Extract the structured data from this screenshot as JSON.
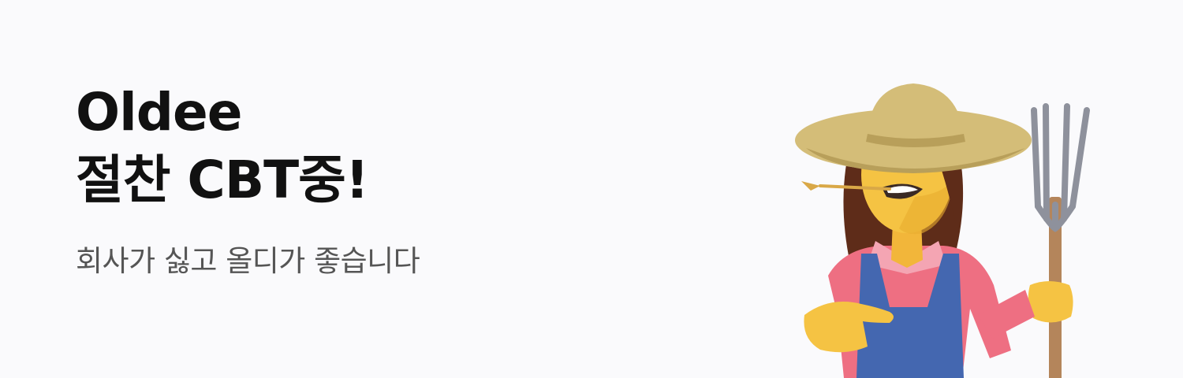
{
  "banner": {
    "title_line1": "Oldee",
    "title_line2": "절찬 CBT중!",
    "subtitle": "회사가 싫고 올디가 좋습니다"
  },
  "illustration": {
    "icon": "farmer-with-pitchfork-illustration",
    "colors": {
      "background": "#fafafc",
      "hat": "#d4bd78",
      "hat_shadow": "#b89f5a",
      "hair": "#5e2c19",
      "skin": "#f5c343",
      "shirt": "#ee6f82",
      "overalls": "#4467b0",
      "fork_metal": "#8e919c",
      "fork_handle": "#b4855b"
    }
  }
}
